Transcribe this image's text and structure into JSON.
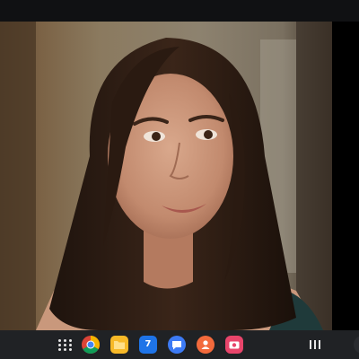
{
  "dock": {
    "calendar_date": "7"
  },
  "colors": {
    "taskbar_bg": "#202225",
    "top_strip_bg": "#101113",
    "chrome_red": "#db4437",
    "chrome_yellow": "#f4b400",
    "chrome_green": "#0f9d58",
    "chrome_blue": "#4285f4",
    "files_yellow": "#f7b928",
    "calendar_blue": "#1e74e8",
    "messages_blue": "#3d7bf5",
    "contacts_orange": "#f36a3c",
    "screen_recorder_pink": "#e8456b"
  },
  "icons": {
    "app_grid": "app-grid-icon",
    "chrome": "chrome-icon",
    "files": "folder-icon",
    "calendar": "calendar-icon",
    "messages": "messages-icon",
    "contacts": "contacts-icon",
    "screen_recorder": "screen-recorder-icon",
    "recents": "recents-icon"
  }
}
